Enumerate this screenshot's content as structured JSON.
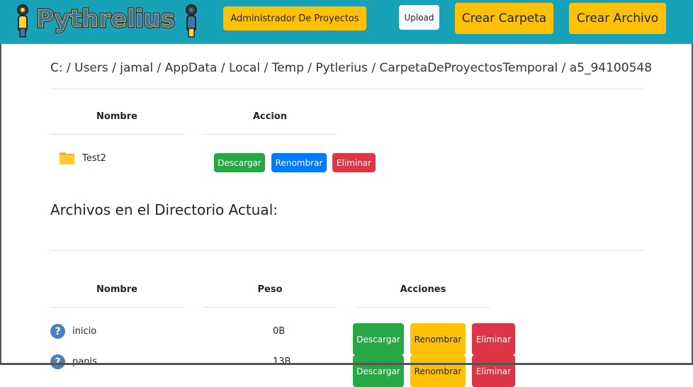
{
  "header": {
    "logo_text": "Pythrelius",
    "admin_label": "Administrador De Proyectos",
    "upload_label": "Upload",
    "crear_carpeta_label": "Crear Carpeta",
    "crear_archivo_label": "Crear Archivo",
    "colors": {
      "bar": "#17a2b8",
      "warning": "#ffc107",
      "light": "#f8f9fa"
    }
  },
  "breadcrumb": "C: / Users / jamal / AppData / Local / Temp / Pytlerius / CarpetaDeProyectosTemporal / a5_94100548",
  "folders_table": {
    "headers": [
      "Nombre",
      "Accion"
    ],
    "rows": [
      {
        "name": "Test2",
        "icon": "folder-icon",
        "actions": [
          "Descargar",
          "Renombrar",
          "Eliminar"
        ]
      }
    ]
  },
  "files_section_title": "Archivos en el Directorio Actual:",
  "files_table": {
    "headers": [
      "Nombre",
      "Peso",
      "Acciones"
    ],
    "rows": [
      {
        "name": "inicio",
        "size": "0B",
        "icon": "question-icon",
        "actions": [
          "Descargar",
          "Renombrar",
          "Eliminar"
        ]
      },
      {
        "name": "panis",
        "size": "13B",
        "icon": "question-icon",
        "actions": [
          "Descargar",
          "Renombrar",
          "Eliminar"
        ]
      }
    ]
  }
}
